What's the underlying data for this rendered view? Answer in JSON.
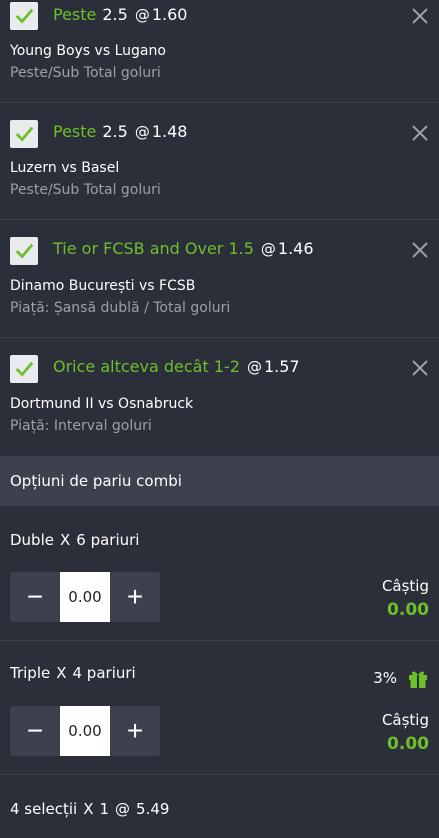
{
  "bets": [
    {
      "selection": "Peste",
      "handicap": "2.5",
      "at": "@",
      "odds": "1.60",
      "match": "Young Boys vs Lugano",
      "market": "Peste/Sub Total goluri"
    },
    {
      "selection": "Peste",
      "handicap": "2.5",
      "at": "@",
      "odds": "1.48",
      "match": "Luzern vs Basel",
      "market": "Peste/Sub Total goluri"
    },
    {
      "selection": "Tie or FCSB and Over 1.5",
      "handicap": "",
      "at": "@",
      "odds": "1.46",
      "match": "Dinamo București vs FCSB",
      "market": "Piață: Șansă dublă / Total goluri"
    },
    {
      "selection": "Orice altceva decât 1-2",
      "handicap": "",
      "at": "@",
      "odds": "1.57",
      "match": "Dortmund II vs Osnabruck",
      "market": "Piață: Interval goluri"
    }
  ],
  "combi": {
    "header": "Opțiuni de pariu combi",
    "options": [
      {
        "type": "Duble",
        "x": "X",
        "count": "6 pariuri",
        "stake": "0.00",
        "gain_label": "Câștig",
        "gain": "0.00",
        "minus": "−",
        "plus": "+"
      },
      {
        "type": "Triple",
        "x": "X",
        "count": "4 pariuri",
        "stake": "0.00",
        "gain_label": "Câștig",
        "gain": "0.00",
        "bonus": "3%",
        "minus": "−",
        "plus": "+"
      }
    ],
    "summary": {
      "selections": "4 selecții",
      "x": "X",
      "count": "1",
      "at": "@",
      "odds": "5.49"
    }
  },
  "colors": {
    "accent": "#6fbf2a",
    "background": "#2b2f3a",
    "muted": "#9aa0aa"
  },
  "icons": {
    "check": "check-icon",
    "close": "close-icon",
    "gift": "gift-icon"
  }
}
